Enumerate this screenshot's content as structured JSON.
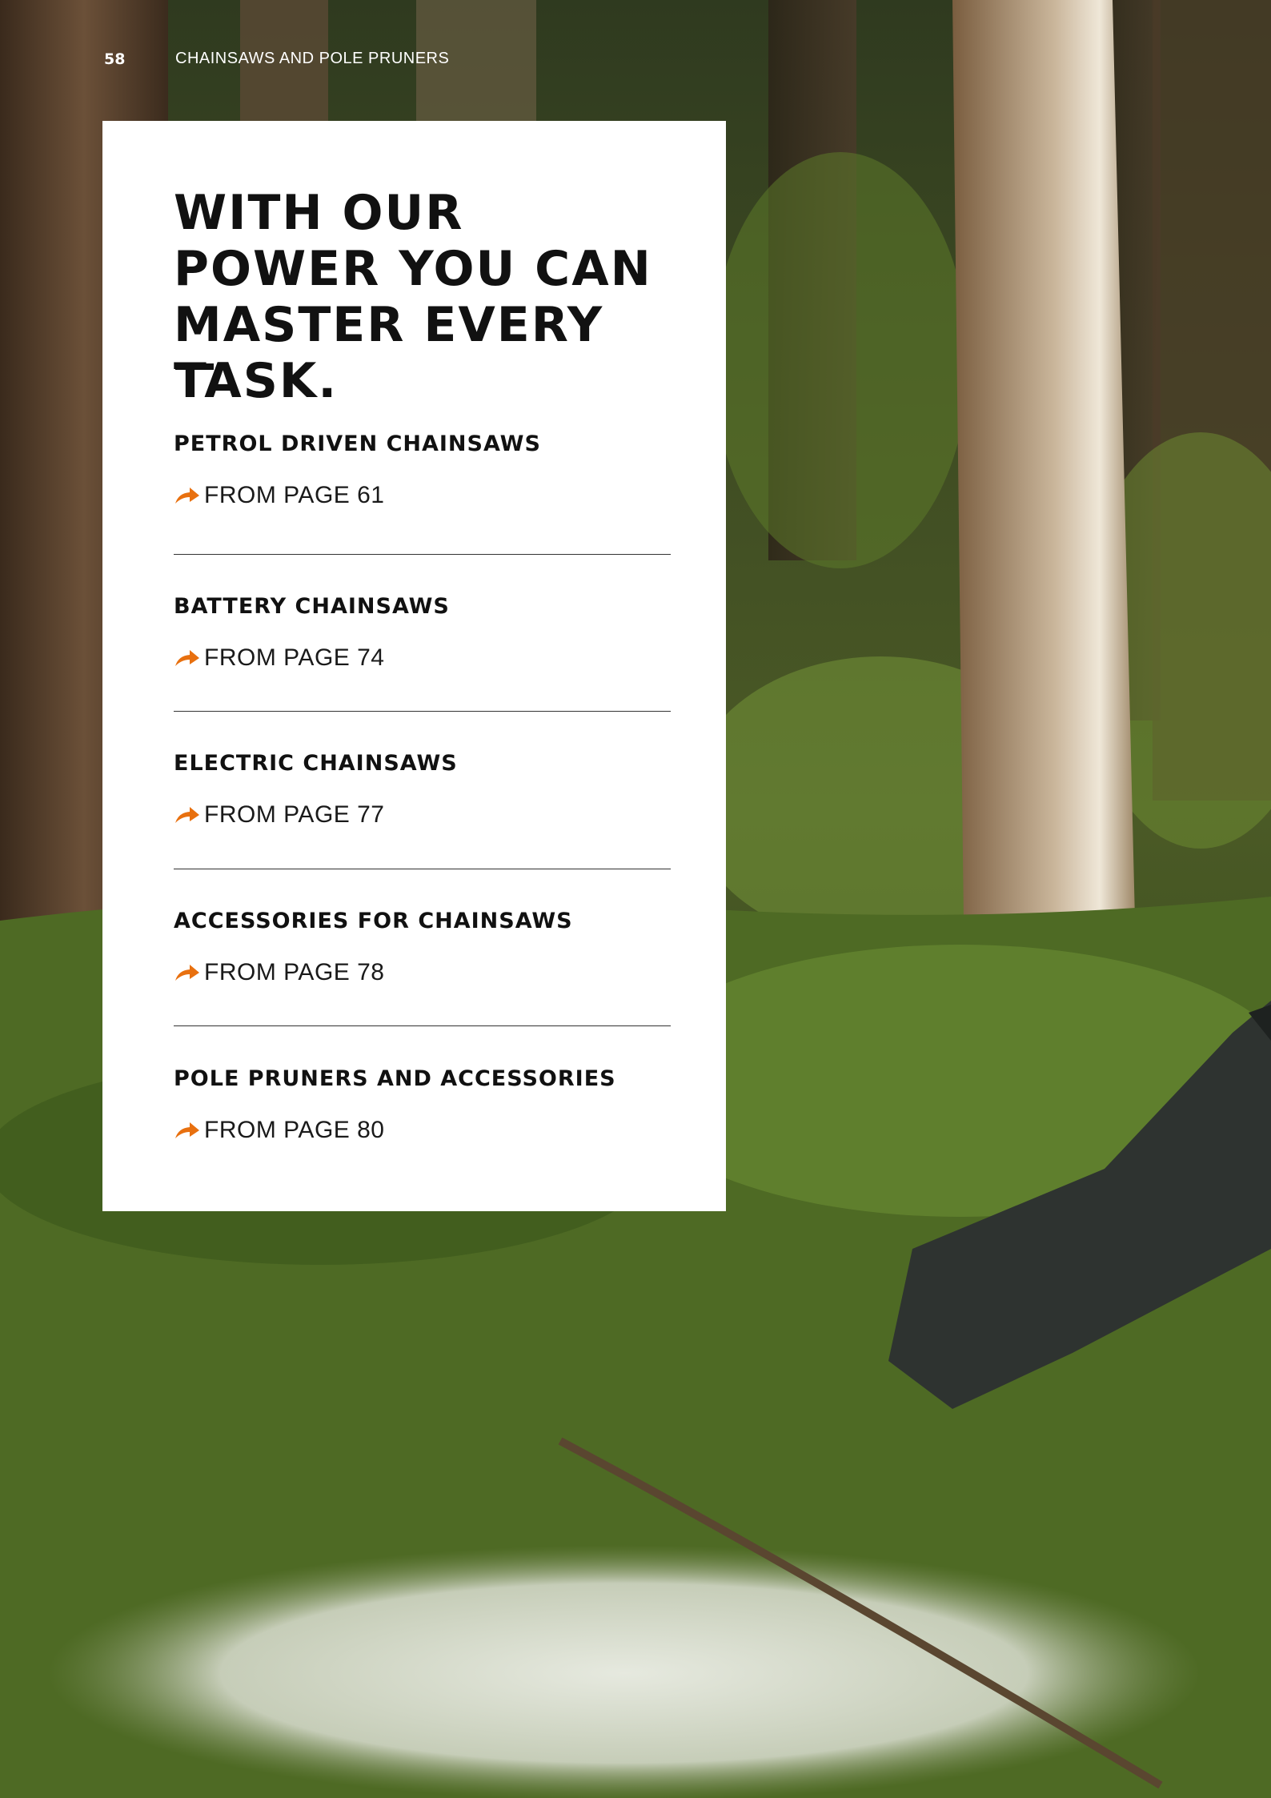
{
  "header": {
    "page_number": "58",
    "section": "CHAINSAWS AND POLE PRUNERS"
  },
  "card": {
    "headline": "WITH OUR POWER YOU CAN MASTER EVERY TASK.",
    "categories": [
      {
        "title": "PETROL DRIVEN CHAINSAWS",
        "link": "FROM PAGE 61"
      },
      {
        "title": "BATTERY CHAINSAWS",
        "link": "FROM PAGE 74"
      },
      {
        "title": "ELECTRIC CHAINSAWS",
        "link": "FROM PAGE 77"
      },
      {
        "title": "ACCESSORIES FOR CHAINSAWS",
        "link": "FROM PAGE 78"
      },
      {
        "title": "POLE PRUNERS AND ACCESSORIES",
        "link": "FROM PAGE 80"
      }
    ]
  },
  "colors": {
    "accent": "#e8700f",
    "card_bg": "#ffffff",
    "text": "#111111"
  },
  "icons": {
    "link": "arrow-right-icon"
  }
}
